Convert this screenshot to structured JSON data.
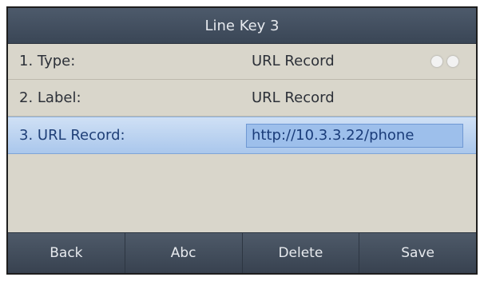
{
  "title": "Line Key 3",
  "rows": [
    {
      "label": "1. Type:",
      "value": "URL Record"
    },
    {
      "label": "2. Label:",
      "value": "URL Record"
    },
    {
      "label": "3. URL Record:",
      "value": "http://10.3.3.22/phone"
    }
  ],
  "softkeys": [
    "Back",
    "Abc",
    "Delete",
    "Save"
  ],
  "colors": {
    "screen_bg": "#d9d6cb",
    "titlebar_bg": "#3f4b5b",
    "selected_bg": "#aac7ec",
    "softkey_bg": "#404b59"
  },
  "icons": {
    "type_selector": "left-right-arrow-icons"
  }
}
